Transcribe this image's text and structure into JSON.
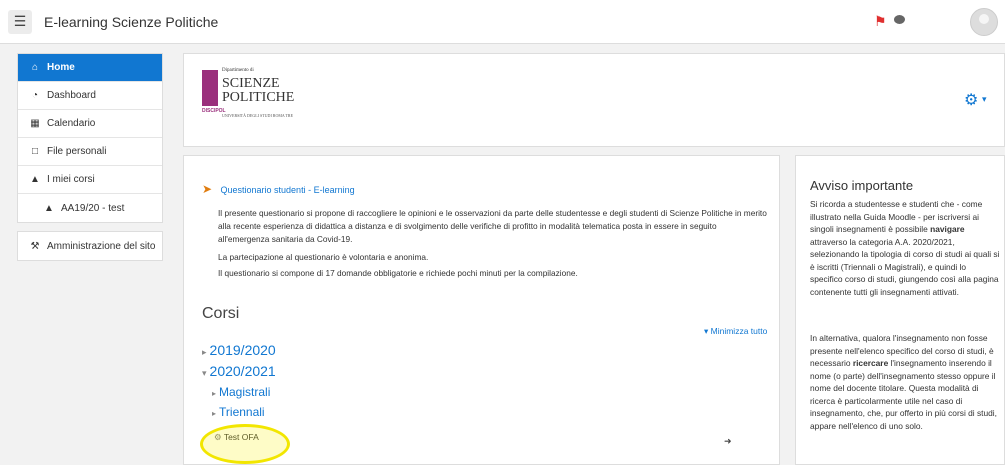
{
  "topbar": {
    "menu_icon": "hamburger-icon",
    "site_name": "E-learning Scienze Politiche",
    "notification_icon": "bell-icon",
    "messages_icon": "chat-icon",
    "avatar_icon": "user-avatar-icon"
  },
  "sidebar": {
    "primary": [
      {
        "label": "Home",
        "icon": "home-icon",
        "active": true
      },
      {
        "label": "Dashboard",
        "icon": "dashboard-icon"
      },
      {
        "label": "Calendario",
        "icon": "calendar-icon"
      },
      {
        "label": "File personali",
        "icon": "file-icon"
      },
      {
        "label": "I miei corsi",
        "icon": "graduation-cap-icon"
      },
      {
        "label": "AA19/20 - test",
        "icon": "graduation-cap-icon"
      }
    ],
    "admin": {
      "label": "Amministrazione del sito",
      "icon": "wrench-icon"
    }
  },
  "header": {
    "logo": {
      "dept": "Dipartimento di",
      "line1": "SCIENZE",
      "line2": "POLITICHE",
      "tag": "DISCIPOL",
      "university": "UNIVERSITÀ DEGLI STUDI ROMA TRE"
    },
    "settings_icon": "gear-icon"
  },
  "main": {
    "notice_link": "Questionario studenti - E-learning",
    "notice_icon": "megaphone-icon",
    "paragraphs": [
      "Il presente questionario si propone di raccogliere le opinioni e le osservazioni da parte delle studentesse e degli studenti di Scienze Politiche in merito alla recente esperienza di didattica a distanza e di svolgimento delle verifiche di profitto in modalità telematica posta in essere in seguito all'emergenza sanitaria da Covid-19.",
      "La partecipazione al questionario è volontaria e anonima.",
      "Il questionario si compone di 17 domande obbligatorie e richiede pochi minuti per la compilazione."
    ],
    "courses_heading": "Corsi",
    "collapse_all": "Minimizza tutto",
    "years": [
      {
        "label": "2019/2020",
        "expanded": false
      },
      {
        "label": "2020/2021",
        "expanded": true
      }
    ],
    "subcategories": [
      "Magistrali",
      "Triennali"
    ],
    "test_ofa": "Test OFA",
    "highlight_color": "#f2e600"
  },
  "side": {
    "title": "Avviso importante",
    "p1_a": "Si ricorda a studentesse e studenti che - come illustrato nella Guida Moodle - per iscriversi ai singoli insegnamenti è possibile ",
    "p1_b": "navigare",
    "p1_c": " attraverso la categoria A.A. 2020/2021, selezionando la tipologia di corso di studi ai quali si è iscritti (Triennali o Magistrali), e quindi lo specifico corso di studi, giungendo così alla pagina contenente tutti gli insegnamenti attivati.",
    "p2_a": "In alternativa, qualora l'insegnamento non fosse presente nell'elenco specifico del corso di studi, è necessario ",
    "p2_b": "ricercare",
    "p2_c": " l'insegnamento inserendo il nome (o parte) dell'insegnamento stesso oppure il nome del docente titolare. Questa modalità di ricerca è particolarmente utile nel caso di insegnamento, che, pur offerto in più corsi di studi, appare nell'elenco di uno solo."
  },
  "colors": {
    "accent": "#1177d1",
    "brand": "#9a2f7c"
  }
}
